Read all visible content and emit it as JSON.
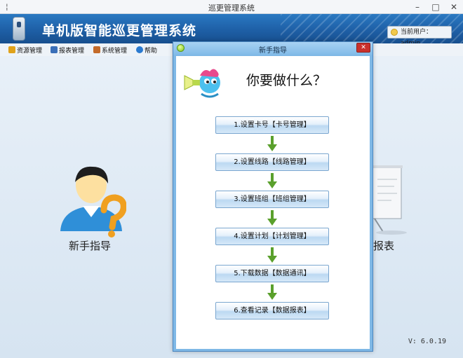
{
  "window": {
    "title": "巡更管理系统",
    "app_glyph": "¦"
  },
  "banner": {
    "app_title": "单机版智能巡更管理系统",
    "current_user": "当前用户：admin"
  },
  "menu": {
    "items": [
      {
        "label": "资源管理",
        "icon": "folder-icon",
        "color": "#e0a21a"
      },
      {
        "label": "报表管理",
        "icon": "report-icon",
        "color": "#3a6fb8"
      },
      {
        "label": "系统管理",
        "icon": "toolbox-icon",
        "color": "#c46b2a"
      },
      {
        "label": "帮助",
        "icon": "help-icon",
        "color": "#2a7ad0"
      }
    ]
  },
  "workspace": {
    "guide_tile_label": "新手指导",
    "report_tile_label": "报表",
    "version": "V: 6.0.19"
  },
  "dialog": {
    "title": "新手指导",
    "close_label": "✕",
    "heading": "你要做什么？",
    "steps": [
      "1.设置卡号【卡号管理】",
      "2.设置线路【线路管理】",
      "3.设置班组【班组管理】",
      "4.设置计划【计划管理】",
      "5.下载数据【数据通讯】",
      "6.查看记录【数据报表】"
    ]
  },
  "colors": {
    "banner": "#1e5fa6",
    "arrow": "#5aa02c",
    "close": "#c9302c"
  }
}
